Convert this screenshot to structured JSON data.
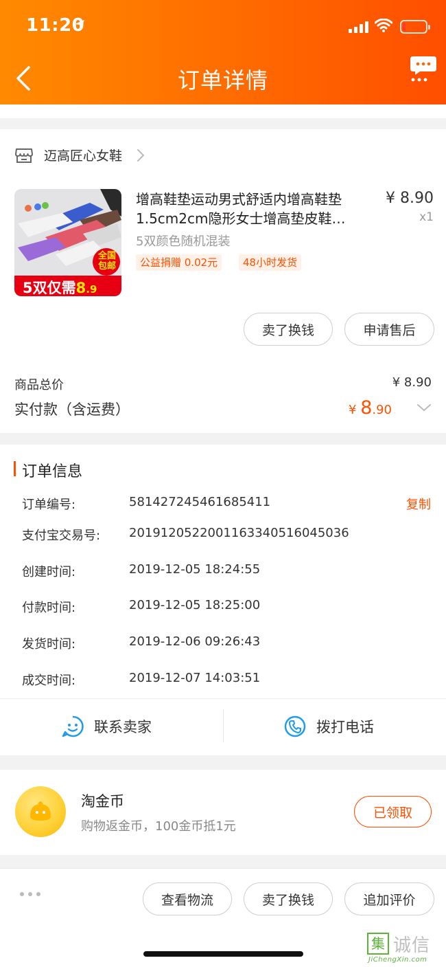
{
  "status_bar": {
    "time": "11:20"
  },
  "nav": {
    "title": "订单详情"
  },
  "shop": {
    "name": "迈高匠心女鞋"
  },
  "product": {
    "title": "增高鞋垫运动男式舒适内增高鞋垫1.5cm2cm隐形女士增高垫皮鞋…",
    "price": "¥ 8.90",
    "quantity": "x1",
    "variant": "5双颜色随机混装",
    "tags": [
      "公益捐赠 0.02元",
      "48小时发货"
    ],
    "image_text": {
      "badge": "全国包邮",
      "banner_prefix": "5双仅需",
      "banner_price_int": "8",
      "banner_price_dec": ".9"
    }
  },
  "item_actions": {
    "sell_label": "卖了换钱",
    "after_sale_label": "申请售后"
  },
  "summary": {
    "total_label": "商品总价",
    "total_value": "¥ 8.90",
    "paid_label": "实付款（含运费）",
    "paid_currency": "¥ ",
    "paid_int": "8",
    "paid_dec": ".90"
  },
  "order_info": {
    "section_title": "订单信息",
    "copy_label": "复制",
    "rows": [
      {
        "label": "订单编号:",
        "value": "581427245461685411"
      },
      {
        "label": "支付宝交易号:",
        "value": "2019120522001163340516045036"
      },
      {
        "label": "创建时间:",
        "value": "2019-12-05 18:24:55"
      },
      {
        "label": "付款时间:",
        "value": "2019-12-05 18:25:00"
      },
      {
        "label": "发货时间:",
        "value": "2019-12-06 09:26:43"
      },
      {
        "label": "成交时间:",
        "value": "2019-12-07 14:03:51"
      }
    ]
  },
  "contact": {
    "seller_label": "联系卖家",
    "phone_label": "拨打电话"
  },
  "coins": {
    "title": "淘金币",
    "subtitle": "购物返金币，100金币抵1元",
    "button_label": "已领取"
  },
  "bottom_bar": {
    "logistics_label": "查看物流",
    "sell_label": "卖了换钱",
    "review_label": "追加评价"
  },
  "watermark": {
    "cn": "诚信",
    "logo": "集",
    "en": "JiChengXin.com"
  },
  "colors": {
    "accent": "#ff5000",
    "header_start": "#ff8a00",
    "header_end": "#ff4e00",
    "contact_icon": "#1e9bea"
  }
}
